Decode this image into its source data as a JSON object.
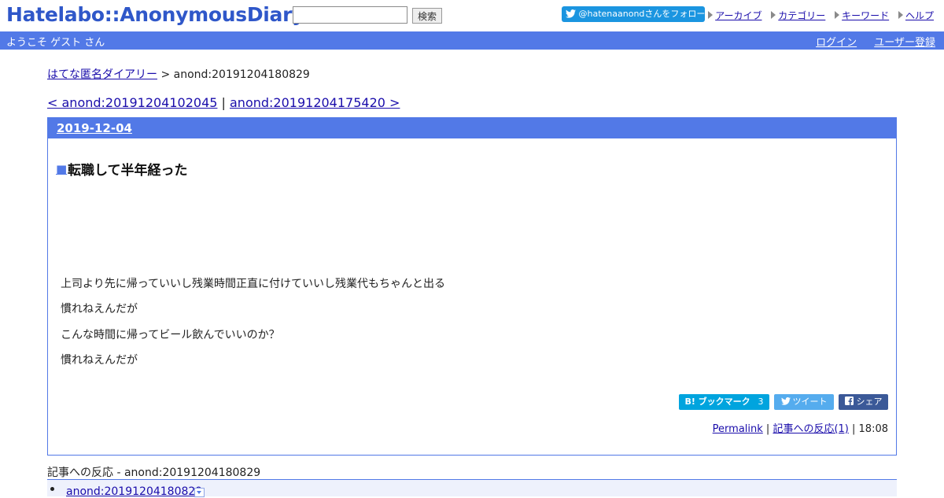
{
  "header": {
    "logo": "Hatelabo::AnonymousDiary",
    "search_button": "検索",
    "twitter_follow": "@hatenaanondさんをフォロー",
    "links": [
      "アーカイブ",
      "カテゴリー",
      "キーワード",
      "ヘルプ"
    ]
  },
  "bar": {
    "welcome": "ようこそ ゲスト さん",
    "login": "ログイン",
    "register": "ユーザー登録"
  },
  "breadcrumb": {
    "home": "はてな匿名ダイアリー",
    "separator": " > ",
    "current": "anond:20191204180829"
  },
  "pager": {
    "prev": "< anond:20191204102045",
    "separator": " | ",
    "next": "anond:20191204175420 >"
  },
  "entry": {
    "date": "2019-12-04",
    "title_mark": "■",
    "title": "転職して半年経った",
    "lines": [
      "上司より先に帰っていいし残業時間正直に付けていいし残業代もちゃんと出る",
      "慣れねえんだが",
      "こんな時間に帰ってビール飲んでいいのか？",
      "慣れねえんだが"
    ],
    "share": {
      "hatena_label": "B! ブックマーク",
      "hatena_count": "3",
      "tweet_label": "ツイート",
      "share_label": "シェア"
    },
    "permalink": "Permalink",
    "reactions": "記事への反応(1)",
    "time": "18:08"
  },
  "refs": {
    "title": "記事への反応 - anond:20191204180829",
    "items": [
      "anond:20191204180829"
    ]
  },
  "colors": {
    "accent": "#5279e7",
    "logo": "#2f57c9",
    "twitter": "#1b95e0",
    "hatena": "#00a4de",
    "facebook": "#3b5998"
  }
}
